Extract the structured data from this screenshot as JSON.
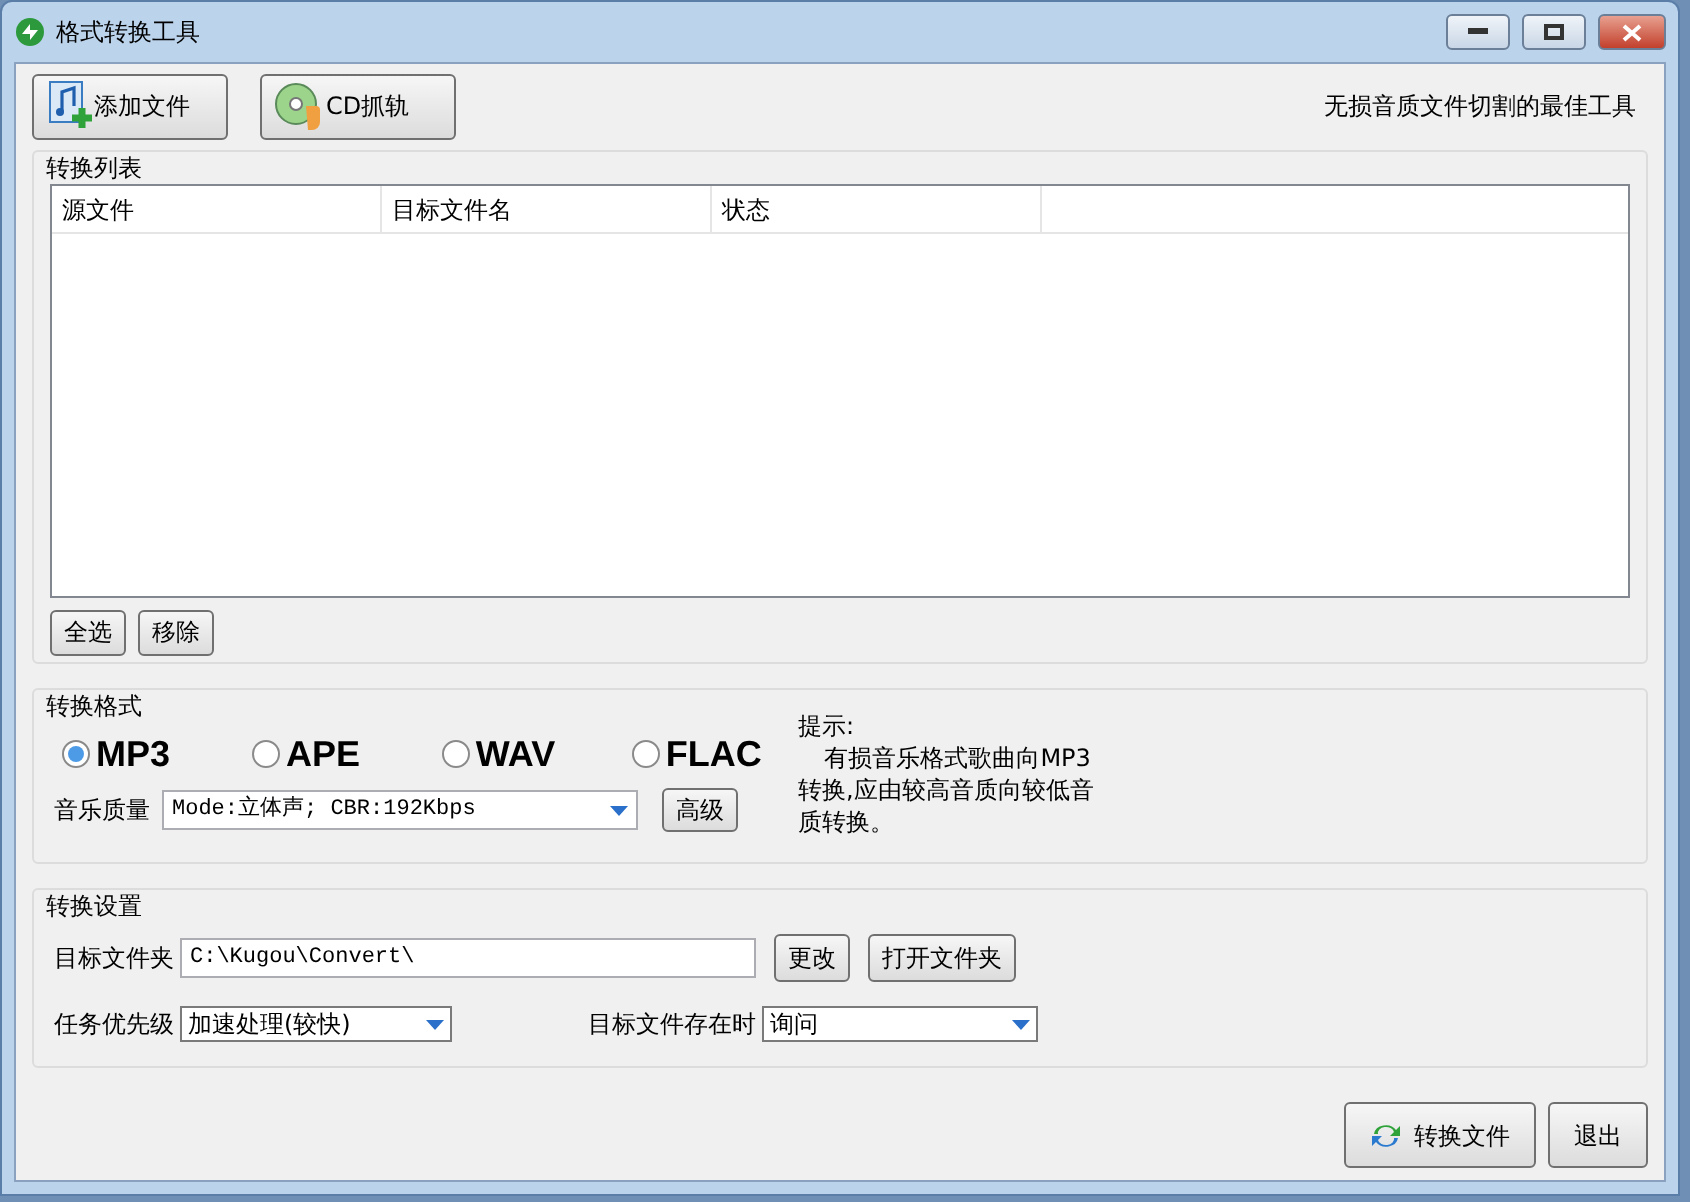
{
  "window": {
    "title": "格式转换工具"
  },
  "toolbar": {
    "buttons": [
      "添加文件",
      "CD抓轨"
    ],
    "slogan": "无损音质文件切割的最佳工具"
  },
  "conversion_list": {
    "title": "转换列表",
    "columns": [
      "源文件",
      "目标文件名",
      "状态"
    ],
    "buttons": [
      "全选",
      "移除"
    ]
  },
  "format": {
    "title": "转换格式",
    "options": [
      {
        "label": "MP3",
        "selected": true
      },
      {
        "label": "APE",
        "selected": false
      },
      {
        "label": "WAV",
        "selected": false
      },
      {
        "label": "FLAC",
        "selected": false
      }
    ],
    "quality_label": "音乐质量",
    "quality_value": "Mode:立体声; CBR:192Kbps",
    "advanced_button": "高级",
    "hint_title": "提示:",
    "hint_text": "有损音乐格式歌曲向MP3转换,应由较高音质向较低音质转换。"
  },
  "settings": {
    "title": "转换设置",
    "folder_label": "目标文件夹",
    "folder_value": "C:\\Kugou\\Convert\\",
    "buttons": [
      "更改",
      "打开文件夹"
    ],
    "priority_label": "任务优先级",
    "priority_value": "加速处理(较快)",
    "exists_label": "目标文件存在时",
    "exists_value": "询问"
  },
  "footer": {
    "buttons": [
      "转换文件",
      "退出"
    ]
  }
}
